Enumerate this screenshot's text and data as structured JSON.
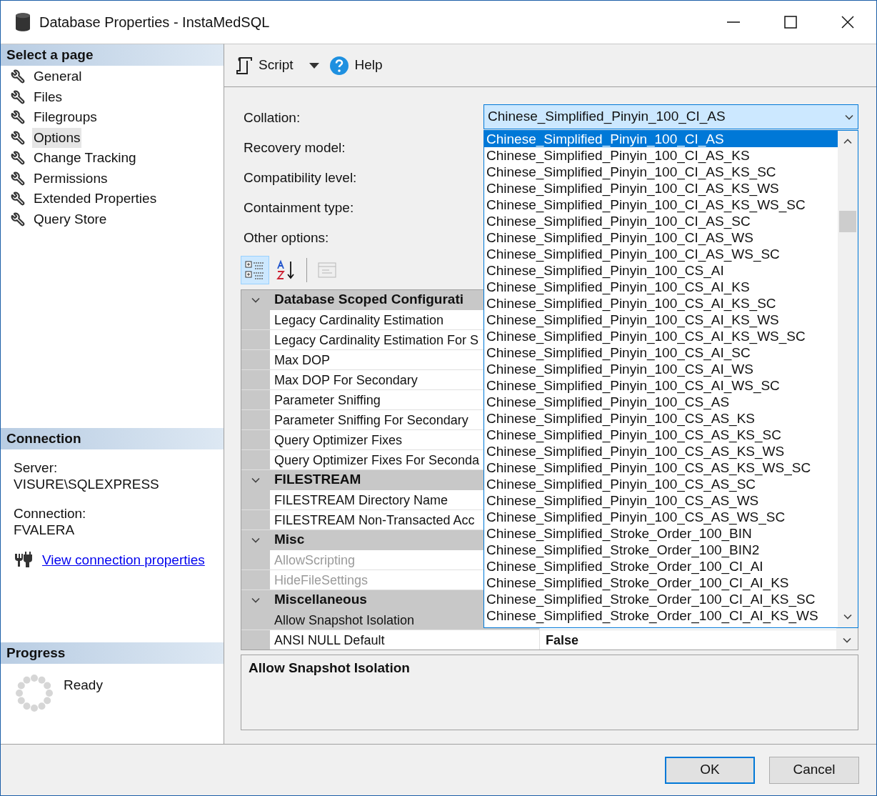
{
  "window": {
    "title": "Database Properties - InstaMedSQL"
  },
  "sidebar": {
    "header": "Select a page",
    "items": [
      {
        "label": "General",
        "selected": false
      },
      {
        "label": "Files",
        "selected": false
      },
      {
        "label": "Filegroups",
        "selected": false
      },
      {
        "label": "Options",
        "selected": true
      },
      {
        "label": "Change Tracking",
        "selected": false
      },
      {
        "label": "Permissions",
        "selected": false
      },
      {
        "label": "Extended Properties",
        "selected": false
      },
      {
        "label": "Query Store",
        "selected": false
      }
    ]
  },
  "connection": {
    "header": "Connection",
    "server_label": "Server:",
    "server": "VISURE\\SQLEXPRESS",
    "connection_label": "Connection:",
    "connection": "FVALERA",
    "link": "View connection properties"
  },
  "progress": {
    "header": "Progress",
    "status": "Ready"
  },
  "toolbar": {
    "script": "Script",
    "help": "Help"
  },
  "fields": [
    {
      "label": "Collation:",
      "value": "Chinese_Simplified_Pinyin_100_CI_AS",
      "open": true
    },
    {
      "label": "Recovery model:"
    },
    {
      "label": "Compatibility level:"
    },
    {
      "label": "Containment type:"
    }
  ],
  "other_options": "Other options:",
  "grid_toolbar": [
    {
      "kind": "categorized",
      "selected": true
    },
    {
      "kind": "alphabetical",
      "selected": false
    },
    {
      "kind": "property-pages",
      "disabled": true
    }
  ],
  "property_grid": {
    "categories": [
      {
        "name": "Database Scoped Configurati",
        "expanded": true,
        "properties": [
          {
            "name": "Legacy Cardinality Estimation",
            "disabled": false,
            "selected": false
          },
          {
            "name": "Legacy Cardinality Estimation For S",
            "disabled": false,
            "selected": false
          },
          {
            "name": "Max DOP",
            "disabled": false,
            "selected": false
          },
          {
            "name": "Max DOP For Secondary",
            "disabled": false,
            "selected": false
          },
          {
            "name": "Parameter Sniffing",
            "disabled": false,
            "selected": false
          },
          {
            "name": "Parameter Sniffing For Secondary",
            "disabled": false,
            "selected": false
          },
          {
            "name": "Query Optimizer Fixes",
            "disabled": false,
            "selected": false
          },
          {
            "name": "Query Optimizer Fixes For Seconda",
            "disabled": false,
            "selected": false
          }
        ]
      },
      {
        "name": "FILESTREAM",
        "expanded": true,
        "properties": [
          {
            "name": "FILESTREAM Directory Name",
            "disabled": false,
            "selected": false
          },
          {
            "name": "FILESTREAM Non-Transacted Acc",
            "disabled": false,
            "selected": false
          }
        ]
      },
      {
        "name": "Misc",
        "expanded": true,
        "properties": [
          {
            "name": "AllowScripting",
            "disabled": true,
            "selected": false
          },
          {
            "name": "HideFileSettings",
            "disabled": true,
            "selected": false
          }
        ]
      },
      {
        "name": "Miscellaneous",
        "expanded": true,
        "properties": [
          {
            "name": "Allow Snapshot Isolation",
            "disabled": false,
            "selected": true
          },
          {
            "name": "ANSI NULL Default",
            "disabled": false,
            "selected": false,
            "value": "False"
          }
        ]
      }
    ]
  },
  "dropdown": {
    "items": [
      {
        "label": "Chinese_Simplified_Pinyin_100_CI_AS",
        "selected": true
      },
      {
        "label": "Chinese_Simplified_Pinyin_100_CI_AS_KS",
        "selected": false
      },
      {
        "label": "Chinese_Simplified_Pinyin_100_CI_AS_KS_SC",
        "selected": false
      },
      {
        "label": "Chinese_Simplified_Pinyin_100_CI_AS_KS_WS",
        "selected": false
      },
      {
        "label": "Chinese_Simplified_Pinyin_100_CI_AS_KS_WS_SC",
        "selected": false
      },
      {
        "label": "Chinese_Simplified_Pinyin_100_CI_AS_SC",
        "selected": false
      },
      {
        "label": "Chinese_Simplified_Pinyin_100_CI_AS_WS",
        "selected": false
      },
      {
        "label": "Chinese_Simplified_Pinyin_100_CI_AS_WS_SC",
        "selected": false
      },
      {
        "label": "Chinese_Simplified_Pinyin_100_CS_AI",
        "selected": false
      },
      {
        "label": "Chinese_Simplified_Pinyin_100_CS_AI_KS",
        "selected": false
      },
      {
        "label": "Chinese_Simplified_Pinyin_100_CS_AI_KS_SC",
        "selected": false
      },
      {
        "label": "Chinese_Simplified_Pinyin_100_CS_AI_KS_WS",
        "selected": false
      },
      {
        "label": "Chinese_Simplified_Pinyin_100_CS_AI_KS_WS_SC",
        "selected": false
      },
      {
        "label": "Chinese_Simplified_Pinyin_100_CS_AI_SC",
        "selected": false
      },
      {
        "label": "Chinese_Simplified_Pinyin_100_CS_AI_WS",
        "selected": false
      },
      {
        "label": "Chinese_Simplified_Pinyin_100_CS_AI_WS_SC",
        "selected": false
      },
      {
        "label": "Chinese_Simplified_Pinyin_100_CS_AS",
        "selected": false
      },
      {
        "label": "Chinese_Simplified_Pinyin_100_CS_AS_KS",
        "selected": false
      },
      {
        "label": "Chinese_Simplified_Pinyin_100_CS_AS_KS_SC",
        "selected": false
      },
      {
        "label": "Chinese_Simplified_Pinyin_100_CS_AS_KS_WS",
        "selected": false
      },
      {
        "label": "Chinese_Simplified_Pinyin_100_CS_AS_KS_WS_SC",
        "selected": false
      },
      {
        "label": "Chinese_Simplified_Pinyin_100_CS_AS_SC",
        "selected": false
      },
      {
        "label": "Chinese_Simplified_Pinyin_100_CS_AS_WS",
        "selected": false
      },
      {
        "label": "Chinese_Simplified_Pinyin_100_CS_AS_WS_SC",
        "selected": false
      },
      {
        "label": "Chinese_Simplified_Stroke_Order_100_BIN",
        "selected": false
      },
      {
        "label": "Chinese_Simplified_Stroke_Order_100_BIN2",
        "selected": false
      },
      {
        "label": "Chinese_Simplified_Stroke_Order_100_CI_AI",
        "selected": false
      },
      {
        "label": "Chinese_Simplified_Stroke_Order_100_CI_AI_KS",
        "selected": false
      },
      {
        "label": "Chinese_Simplified_Stroke_Order_100_CI_AI_KS_SC",
        "selected": false
      },
      {
        "label": "Chinese_Simplified_Stroke_Order_100_CI_AI_KS_WS",
        "selected": false
      }
    ]
  },
  "description": {
    "title": "Allow Snapshot Isolation"
  },
  "buttons": [
    {
      "label": "OK",
      "default": true
    },
    {
      "label": "Cancel",
      "default": false
    }
  ]
}
